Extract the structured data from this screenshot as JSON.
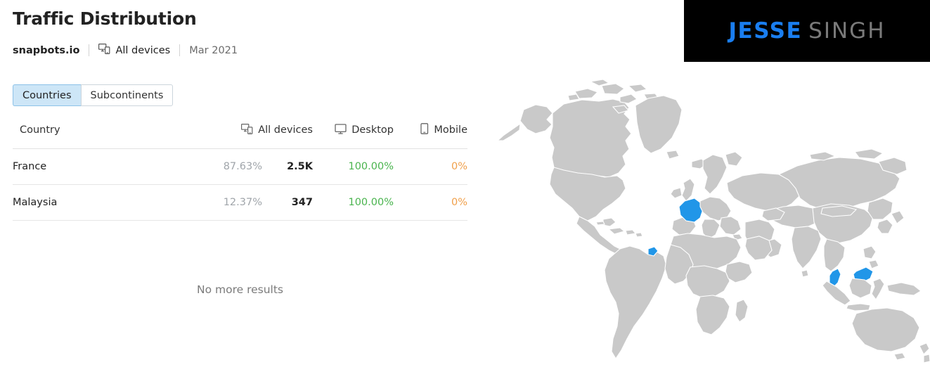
{
  "header": {
    "title": "Traffic Distribution",
    "domain": "snapbots.io",
    "devices_label": "All devices",
    "devices_icon": "all-devices-icon",
    "period": "Mar 2021"
  },
  "tabs": [
    {
      "label": "Countries",
      "active": true
    },
    {
      "label": "Subcontinents",
      "active": false
    }
  ],
  "table": {
    "columns": [
      {
        "key": "country",
        "label": "Country",
        "icon": null
      },
      {
        "key": "all_devices",
        "label": "All devices",
        "icon": "all-devices-icon"
      },
      {
        "key": "desktop",
        "label": "Desktop",
        "icon": "desktop-icon"
      },
      {
        "key": "mobile",
        "label": "Mobile",
        "icon": "mobile-icon"
      }
    ],
    "rows": [
      {
        "country": "France",
        "share": "87.63%",
        "all_devices": "2.5K",
        "desktop": "100.00%",
        "mobile": "0%"
      },
      {
        "country": "Malaysia",
        "share": "12.37%",
        "all_devices": "347",
        "desktop": "100.00%",
        "mobile": "0%"
      }
    ],
    "footer_text": "No more results"
  },
  "logo": {
    "first": "JESSE",
    "last": "SINGH",
    "first_color": "#1a7ef0",
    "last_color": "#7a7a7a",
    "background": "#000000"
  },
  "map": {
    "highlighted_countries": [
      "France",
      "Malaysia"
    ],
    "land_color": "#c9c9c9",
    "highlight_color": "#2196e8",
    "border_color": "#ffffff"
  },
  "colors": {
    "desktop_value": "#4ab44e",
    "mobile_value": "#f0a04b",
    "share_value": "#a0a5aa",
    "tab_active_bg": "#cde6f7",
    "tab_active_border": "#8cc2e8"
  }
}
